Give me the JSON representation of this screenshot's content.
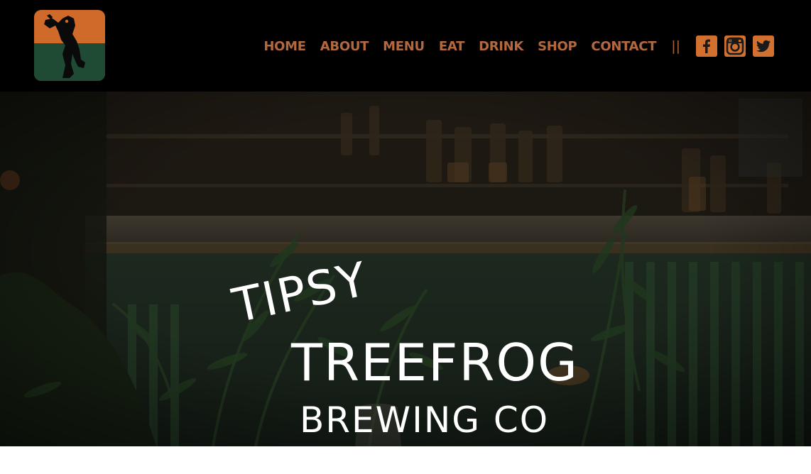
{
  "brand": {
    "logo_icon": "treefrog-logo-icon",
    "colors": {
      "orange": "#cf6a2b",
      "green": "#1f4a34",
      "nav_text": "#b3683d",
      "header_bg": "#000000"
    }
  },
  "nav": {
    "items": [
      {
        "label": "HOME"
      },
      {
        "label": "ABOUT"
      },
      {
        "label": "MENU"
      },
      {
        "label": "EAT"
      },
      {
        "label": "DRINK"
      },
      {
        "label": "SHOP"
      },
      {
        "label": "CONTACT"
      }
    ],
    "separator": "||",
    "social": [
      {
        "icon": "facebook-icon"
      },
      {
        "icon": "instagram-icon"
      },
      {
        "icon": "twitter-icon"
      }
    ]
  },
  "hero": {
    "line1": "TIPSY",
    "line2": "TREEFROG",
    "line3": "BREWING CO",
    "background": "dim-bar-interior-with-plants-photo"
  }
}
